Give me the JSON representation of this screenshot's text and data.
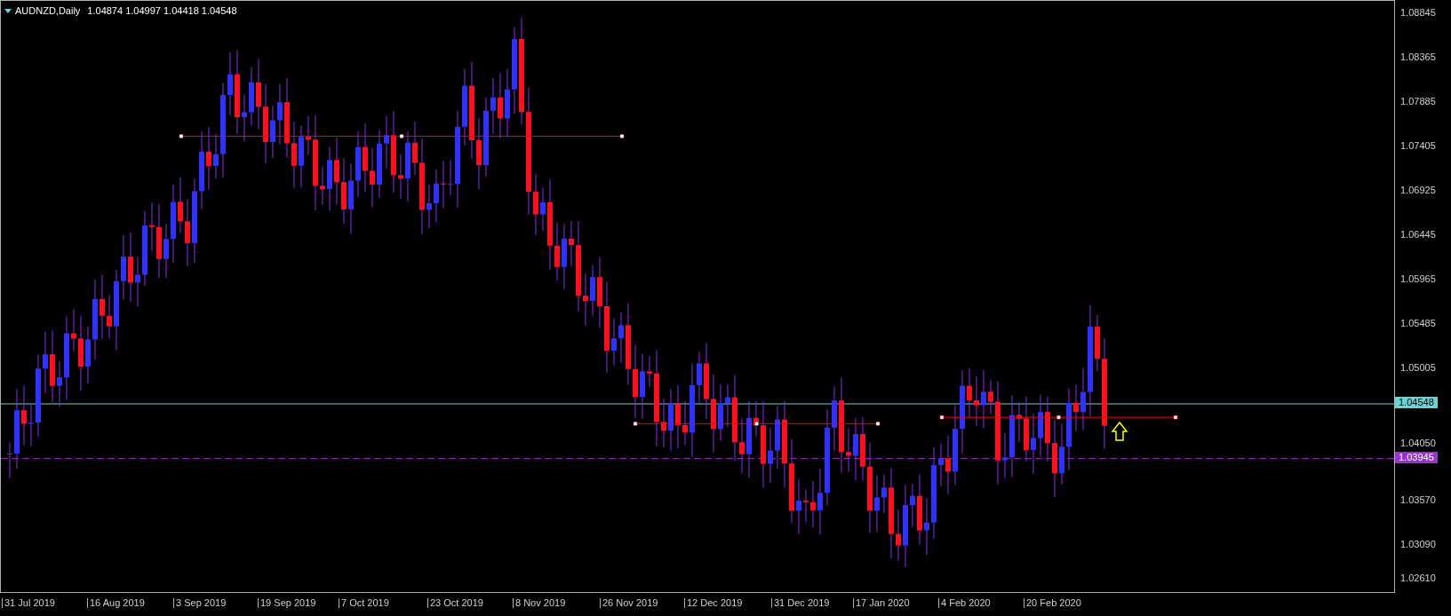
{
  "chart_header": {
    "symbol": "AUDNZD,Daily",
    "quotes": "1.04874 1.04997 1.04418 1.04548"
  },
  "price_axis": [
    "1.08845",
    "1.08365",
    "1.07885",
    "1.07405",
    "1.06925",
    "1.06445",
    "1.05965",
    "1.05485",
    "1.05005",
    "1.04050",
    "1.03570",
    "1.03090",
    "1.02610"
  ],
  "price_markers": [
    {
      "text": "1.04548",
      "color": "#6ad4d4"
    },
    {
      "text": "1.03945",
      "color": "#9932cc"
    }
  ],
  "date_axis": [
    "31 Jul 2019",
    "16 Aug 2019",
    "3 Sep 2019",
    "19 Sep 2019",
    "7 Oct 2019",
    "23 Oct 2019",
    "8 Nov 2019",
    "26 Nov 2019",
    "12 Dec 2019",
    "31 Dec 2019",
    "17 Jan 2020",
    "4 Feb 2020",
    "20 Feb 2020"
  ]
}
